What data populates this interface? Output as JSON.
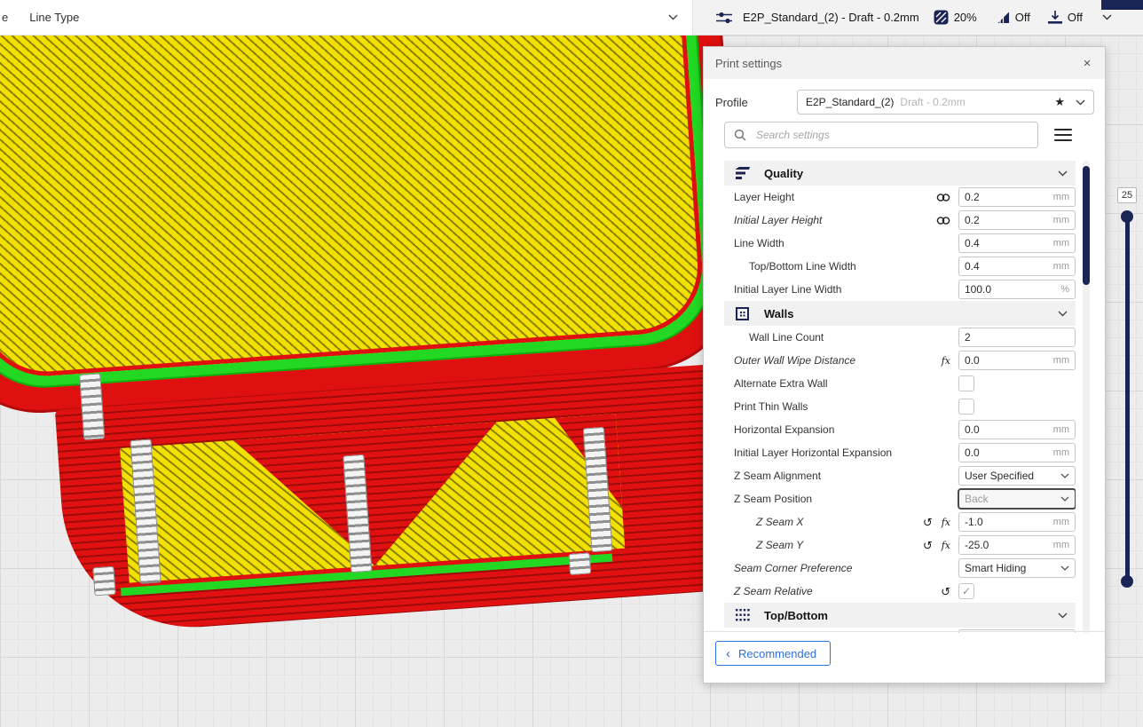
{
  "topbar": {
    "partial_left_text": "e",
    "color_scheme_label": "Line Type",
    "summary": {
      "profile_text": "E2P_Standard_(2) - Draft - 0.2mm",
      "infill_value": "20%",
      "support_value": "Off",
      "adhesion_value": "Off"
    }
  },
  "print_settings": {
    "title": "Print settings",
    "profile": {
      "label": "Profile",
      "name": "E2P_Standard_(2)",
      "variant": "Draft - 0.2mm"
    },
    "search": {
      "placeholder": "Search settings"
    },
    "sections": {
      "quality": {
        "title": "Quality"
      },
      "walls": {
        "title": "Walls"
      },
      "top_bottom": {
        "title": "Top/Bottom"
      }
    },
    "settings": [
      {
        "label": "Layer Height",
        "value": "0.2",
        "unit": "mm"
      },
      {
        "label": "Initial Layer Height",
        "value": "0.2",
        "unit": "mm"
      },
      {
        "label": "Line Width",
        "value": "0.4",
        "unit": "mm"
      },
      {
        "label": "Top/Bottom Line Width",
        "value": "0.4",
        "unit": "mm"
      },
      {
        "label": "Initial Layer Line Width",
        "value": "100.0",
        "unit": "%"
      },
      {
        "label": "Wall Line Count",
        "value": "2",
        "unit": ""
      },
      {
        "label": "Outer Wall Wipe Distance",
        "value": "0.0",
        "unit": "mm"
      },
      {
        "label": "Alternate Extra Wall"
      },
      {
        "label": "Print Thin Walls"
      },
      {
        "label": "Horizontal Expansion",
        "value": "0.0",
        "unit": "mm"
      },
      {
        "label": "Initial Layer Horizontal Expansion",
        "value": "0.0",
        "unit": "mm"
      },
      {
        "label": "Z Seam Alignment",
        "value": "User Specified"
      },
      {
        "label": "Z Seam Position",
        "value": "Back"
      },
      {
        "label": "Z Seam X",
        "value": "-1.0",
        "unit": "mm"
      },
      {
        "label": "Z Seam Y",
        "value": "-25.0",
        "unit": "mm"
      },
      {
        "label": "Seam Corner Preference",
        "value": "Smart Hiding"
      },
      {
        "label": "Z Seam Relative"
      }
    ],
    "footer": {
      "recommended_label": "Recommended"
    }
  },
  "layer_slider": {
    "current_layer": "25"
  },
  "glyphs": {
    "close": "×",
    "star": "★",
    "revert": "↺",
    "fx": "fx",
    "check": "✓",
    "back_chevron": "‹"
  },
  "colors": {
    "accent-blue": "#2f6fe0",
    "icon-navy": "#1b2555",
    "toolbar-bg": "#f2f2f2",
    "model-red": "#df1010",
    "model-green": "#22d822",
    "model-yellow": "#f2e000"
  }
}
